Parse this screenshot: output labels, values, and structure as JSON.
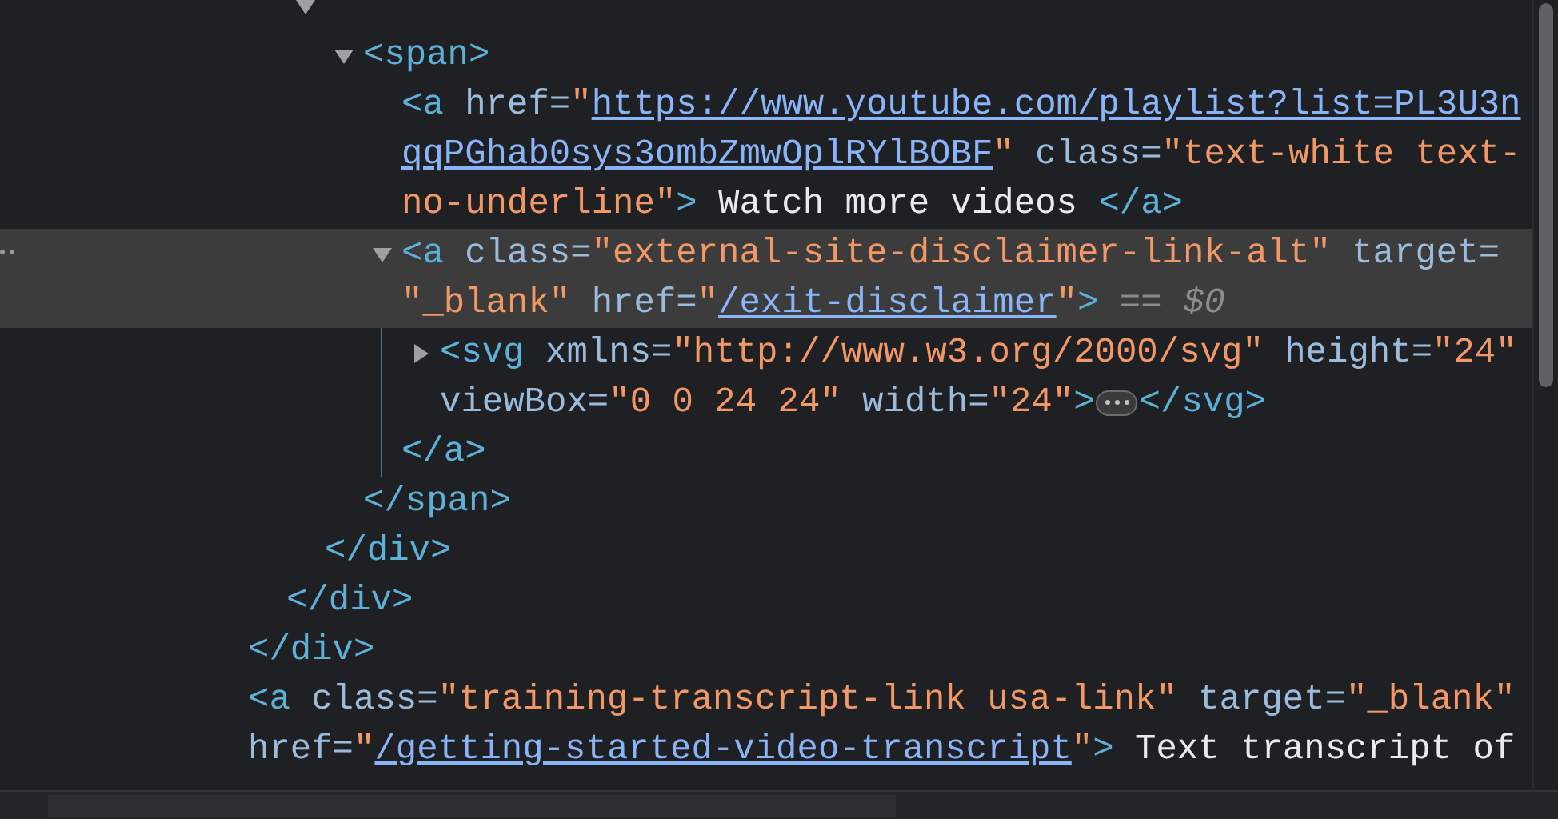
{
  "tree": [
    {
      "close": [
        {
          "kind": "tag",
          "text": "</div>"
        }
      ],
      "children": [
        {
          "close": [
            {
              "kind": "tag",
              "text": "</div>"
            }
          ],
          "children": [
            {
              "expanded": true,
              "close": [
                {
                  "kind": "tag",
                  "text": "</div>"
                }
              ],
              "children": [
                {
                  "expanded": true,
                  "lines": [
                    [
                      {
                        "kind": "tag",
                        "text": "<span>"
                      }
                    ]
                  ],
                  "close": [
                    {
                      "kind": "tag",
                      "text": "</span>"
                    }
                  ],
                  "children": [
                    {
                      "lines": [
                        [
                          {
                            "kind": "tag",
                            "text": "<a"
                          },
                          {
                            "kind": "attr",
                            "text": " href="
                          },
                          {
                            "kind": "value",
                            "text": "\""
                          },
                          {
                            "kind": "link",
                            "text": "https://www.youtube.com/playlist?list=PL3U3n"
                          }
                        ],
                        [
                          {
                            "kind": "link",
                            "text": "qqPGhab0sys3ombZmwOplRYlBOBF"
                          },
                          {
                            "kind": "value",
                            "text": "\""
                          },
                          {
                            "kind": "attr",
                            "text": " class="
                          },
                          {
                            "kind": "value",
                            "text": "\"text-white text-"
                          }
                        ],
                        [
                          {
                            "kind": "value",
                            "text": "no-underline\""
                          },
                          {
                            "kind": "tag",
                            "text": ">"
                          },
                          {
                            "kind": "text",
                            "text": " Watch more videos "
                          },
                          {
                            "kind": "tag",
                            "text": "</a>"
                          }
                        ]
                      ]
                    },
                    {
                      "expanded": true,
                      "selected": true,
                      "lines": [
                        [
                          {
                            "kind": "tag",
                            "text": "<a"
                          },
                          {
                            "kind": "attr",
                            "text": " class="
                          },
                          {
                            "kind": "value",
                            "text": "\"external-site-disclaimer-link-alt\""
                          },
                          {
                            "kind": "attr",
                            "text": " target="
                          }
                        ],
                        [
                          {
                            "kind": "value",
                            "text": "\"_blank\""
                          },
                          {
                            "kind": "attr",
                            "text": " href="
                          },
                          {
                            "kind": "value",
                            "text": "\""
                          },
                          {
                            "kind": "link",
                            "text": "/exit-disclaimer"
                          },
                          {
                            "kind": "value",
                            "text": "\""
                          },
                          {
                            "kind": "tag",
                            "text": ">"
                          },
                          {
                            "kind": "marker",
                            "text": " == *$0*"
                          }
                        ]
                      ],
                      "close": [
                        {
                          "kind": "tag",
                          "text": "</a>"
                        }
                      ],
                      "children": [
                        {
                          "expanded": false,
                          "lines": [
                            [
                              {
                                "kind": "tag",
                                "text": "<svg"
                              },
                              {
                                "kind": "attr",
                                "text": " xmlns="
                              },
                              {
                                "kind": "value",
                                "text": "\"http://www.w3.org/2000/svg\""
                              },
                              {
                                "kind": "attr",
                                "text": " height="
                              },
                              {
                                "kind": "value",
                                "text": "\"24\""
                              }
                            ],
                            [
                              {
                                "kind": "attr",
                                "text": "viewBox="
                              },
                              {
                                "kind": "value",
                                "text": "\"0 0 24 24\""
                              },
                              {
                                "kind": "attr",
                                "text": " width="
                              },
                              {
                                "kind": "value",
                                "text": "\"24\""
                              },
                              {
                                "kind": "tag",
                                "text": ">"
                              },
                              {
                                "kind": "ellipsis"
                              },
                              {
                                "kind": "tag",
                                "text": "</svg>"
                              }
                            ]
                          ]
                        }
                      ]
                    }
                  ]
                }
              ]
            }
          ]
        }
      ]
    },
    {
      "lines": [
        [
          {
            "kind": "tag",
            "text": "<a"
          },
          {
            "kind": "attr",
            "text": " class="
          },
          {
            "kind": "value",
            "text": "\"training-transcript-link usa-link\""
          },
          {
            "kind": "attr",
            "text": " target="
          },
          {
            "kind": "value",
            "text": "\"_blank\""
          }
        ],
        [
          {
            "kind": "attr",
            "text": "href="
          },
          {
            "kind": "value",
            "text": "\""
          },
          {
            "kind": "link",
            "text": "/getting-started-video-transcript"
          },
          {
            "kind": "value",
            "text": "\""
          },
          {
            "kind": "tag",
            "text": ">"
          },
          {
            "kind": "text",
            "text": " Text transcript of"
          }
        ]
      ]
    }
  ]
}
